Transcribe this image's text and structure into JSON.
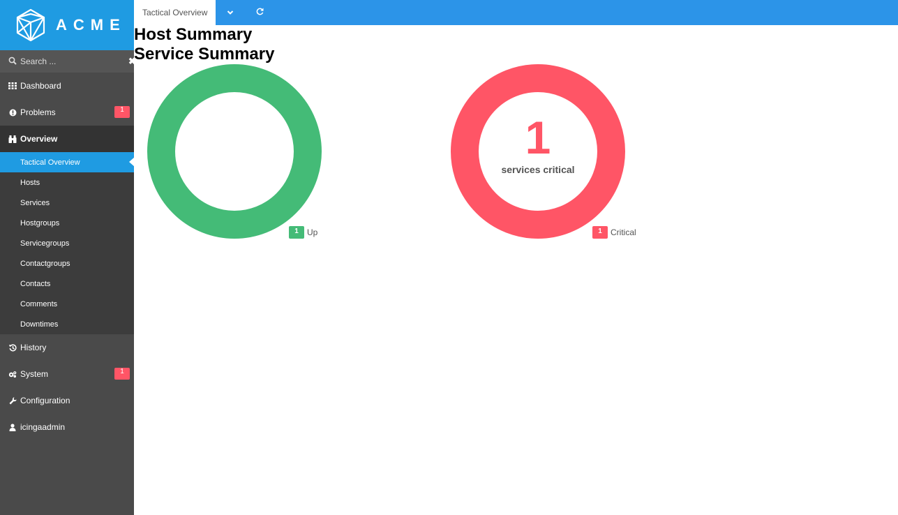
{
  "logo": {
    "wordmark": "ACME"
  },
  "search": {
    "placeholder": "Search ..."
  },
  "nav": {
    "dashboard": "Dashboard",
    "problems": "Problems",
    "problems_badge": "1",
    "overview": "Overview",
    "overview_items": [
      "Tactical Overview",
      "Hosts",
      "Services",
      "Hostgroups",
      "Servicegroups",
      "Contactgroups",
      "Contacts",
      "Comments",
      "Downtimes"
    ],
    "history": "History",
    "system": "System",
    "system_badge": "1",
    "configuration": "Configuration",
    "user": "icingaadmin"
  },
  "topbar": {
    "tab_label": "Tactical Overview"
  },
  "host_summary": {
    "title": "Host Summary",
    "legend_count": "1",
    "legend_label": "Up",
    "color": "#44bb77"
  },
  "service_summary": {
    "title": "Service Summary",
    "center_count": "1",
    "center_label": "services critical",
    "legend_count": "1",
    "legend_label": "Critical",
    "color": "#ff5566"
  },
  "colors": {
    "accent": "#1f9be2",
    "sidebar": "#4a4a4a",
    "up": "#44bb77",
    "critical": "#ff5566"
  }
}
